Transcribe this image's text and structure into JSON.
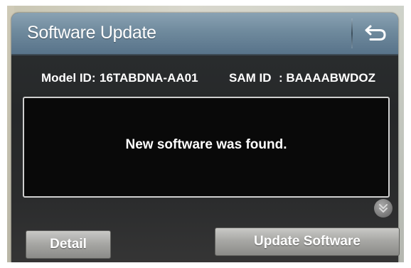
{
  "dialog": {
    "title": "Software Update",
    "back_icon": "back-arrow-icon"
  },
  "ids": {
    "model_label": "Model ID:",
    "model_value": "16TABDNA-AA01",
    "sam_label": "SAM ID",
    "sam_value": ": BAAAABWDOZ"
  },
  "message": {
    "text": "New software was found."
  },
  "scroll": {
    "icon": "chevron-down-icon"
  },
  "buttons": {
    "detail_label": "Detail",
    "update_label": "Update Software"
  },
  "colors": {
    "titlebar": "#6f8a9d",
    "background": "#2a2c2e",
    "message_box": "#090909",
    "button": "#a8a8a5"
  }
}
